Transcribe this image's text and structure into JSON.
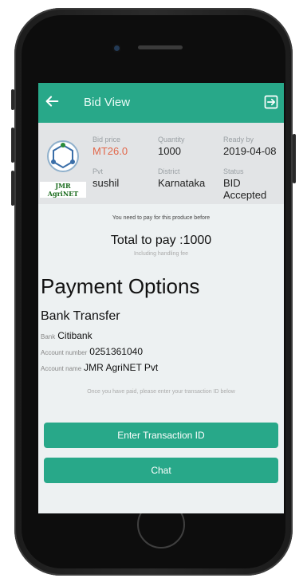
{
  "app_bar": {
    "title": "Bid View"
  },
  "bid": {
    "price_label": "Bid price",
    "price_value": "MT26.0",
    "quantity_label": "Quantity",
    "quantity_value": "1000",
    "ready_label": "Ready by",
    "ready_value": "2019-04-08",
    "buyer_label": "Pvt",
    "buyer_value": "sushil",
    "district_label": "District",
    "district_value": "Karnataka",
    "status_label": "Status",
    "status_value": "BID Accepted",
    "logo_text": "JMR AgriNET"
  },
  "payment": {
    "notice": "You need to pay for this produce before",
    "total": "Total to pay :1000",
    "total_sub": "Including handling fee",
    "title": "Payment Options",
    "method": "Bank Transfer",
    "bank_label": "Bank",
    "bank_value": "Citibank",
    "account_number_label": "Account number",
    "account_number_value": "0251361040",
    "account_name_label": "Account name",
    "account_name_value": "JMR AgriNET Pvt",
    "hint": "Once you have paid, please enter your transaction ID below"
  },
  "buttons": {
    "enter_transaction": "Enter Transaction ID",
    "chat": "Chat"
  },
  "colors": {
    "accent": "#28a889",
    "price": "#e2674a"
  }
}
